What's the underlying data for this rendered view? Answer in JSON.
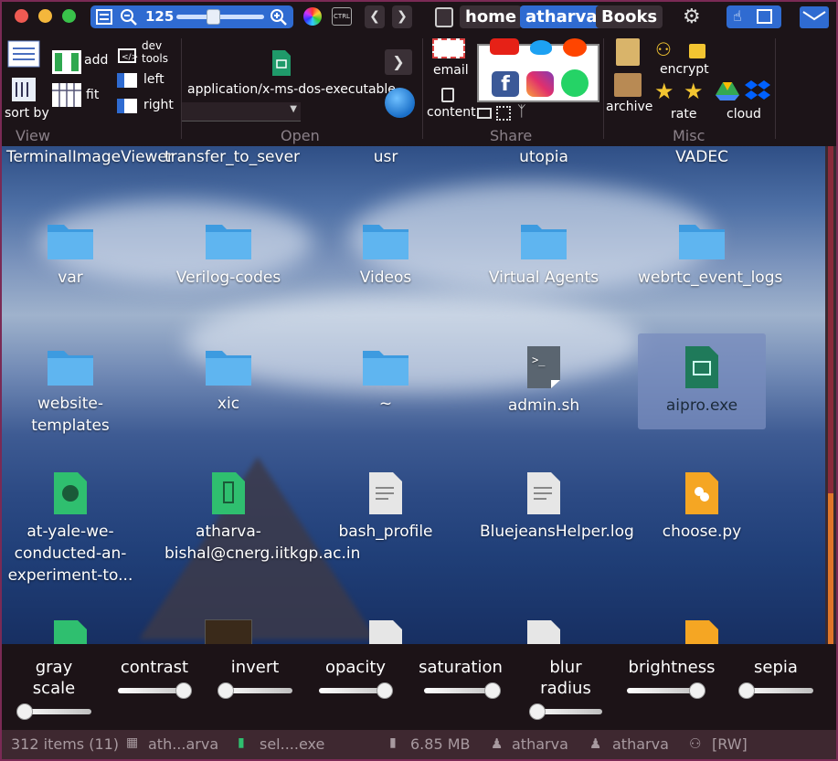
{
  "window": {
    "accent": "#2f6bd1",
    "border": "#7a2a55"
  },
  "topbar": {
    "zoom_value": "125",
    "ctrl_label": "CTRL",
    "tabs": [
      {
        "label": "home",
        "active": false
      },
      {
        "label": "atharva",
        "active": true
      },
      {
        "label": "Books",
        "active": false
      }
    ]
  },
  "ribbon": {
    "view": {
      "title": "View",
      "sort_by": "sort by",
      "add": "add",
      "fit": "fit",
      "dev_tools_line1": "dev",
      "dev_tools_line2": "tools",
      "left": "left",
      "right": "right"
    },
    "open": {
      "title": "Open",
      "mime": "application/x-ms-dos-executable"
    },
    "share": {
      "title": "Share",
      "email": "email",
      "content": "content"
    },
    "misc": {
      "title": "Misc",
      "archive": "archive",
      "encrypt": "encrypt",
      "rate": "rate",
      "cloud": "cloud"
    }
  },
  "files": {
    "row0": [
      "TerminalImageViewer",
      "transfer_to_sever",
      "usr",
      "utopia",
      "VADEC"
    ],
    "row1": [
      "var",
      "Verilog-codes",
      "Videos",
      "Virtual Agents",
      "webrtc_event_logs"
    ],
    "row2": [
      "website-templates",
      "xic",
      "~",
      "admin.sh",
      "aipro.exe"
    ],
    "row3": [
      "at-yale-we-conducted-an-experiment-to...",
      "atharva-bishal@cnerg.iitkgp.ac.in",
      "bash_profile",
      "BluejeansHelper.log",
      "choose.py"
    ]
  },
  "filters": {
    "gray_scale_1": "gray",
    "gray_scale_2": "scale",
    "contrast": "contrast",
    "invert": "invert",
    "opacity": "opacity",
    "saturation": "saturation",
    "blur_1": "blur",
    "blur_2": "radius",
    "brightness": "brightness",
    "sepia": "sepia",
    "levels": {
      "gray_scale": 0.0,
      "contrast": 0.85,
      "invert": 0.0,
      "opacity": 1.0,
      "saturation": 1.0,
      "blur_radius": 0.05,
      "brightness": 1.0,
      "sepia": 0.0
    }
  },
  "status": {
    "items": "312 items (11)",
    "path": "ath...arva",
    "selected": "sel....exe",
    "size": "6.85 MB",
    "owner": "atharva",
    "group": "atharva",
    "perm": "[RW]"
  }
}
